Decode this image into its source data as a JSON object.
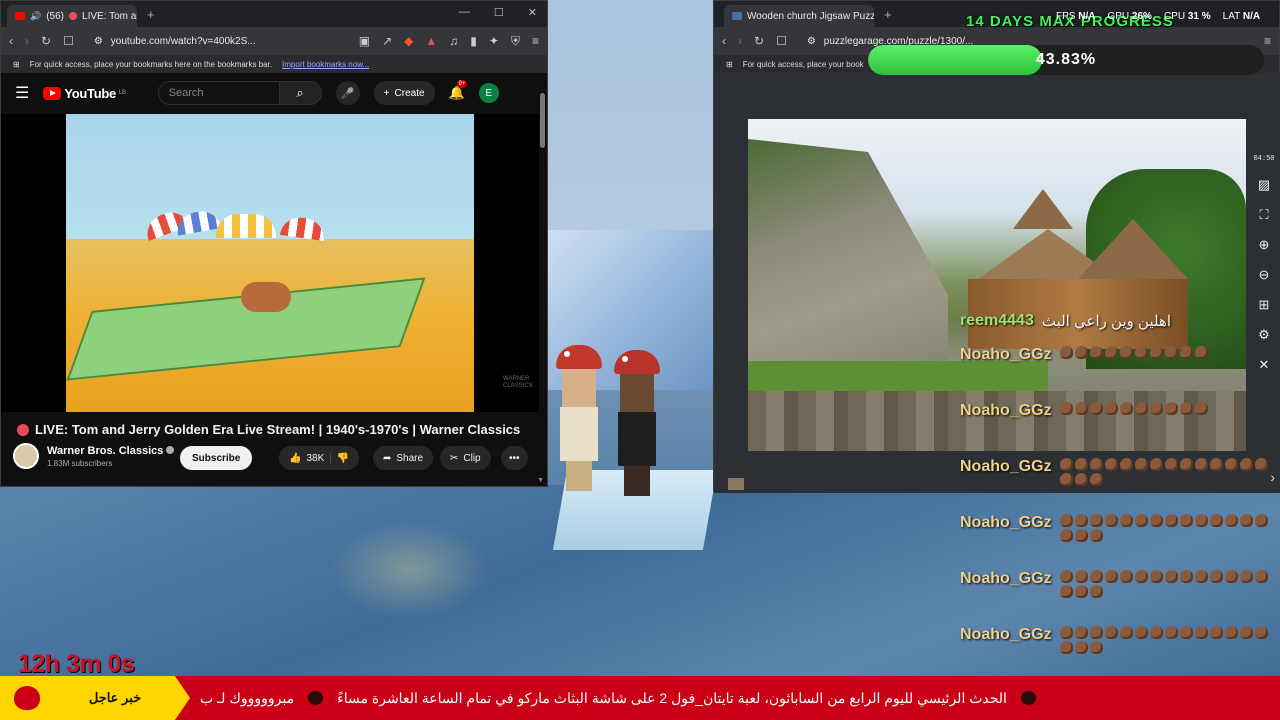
{
  "left_browser": {
    "tab_count": "(56)",
    "tab_title": "LIVE: Tom and Jerry G",
    "url": "youtube.com/watch?v=400k2S...",
    "bookmarks_hint": "For quick access, place your bookmarks here on the bookmarks bar.",
    "import_link": "Import bookmarks now..."
  },
  "youtube": {
    "logo": "YouTube",
    "logo_sup": "LB",
    "search_placeholder": "Search",
    "create_label": "Create",
    "notif_badge": "9+",
    "avatar_letter": "E",
    "video_watermark": "WARNER CLASSICS",
    "video_title": "LIVE: Tom and Jerry Golden Era Live Stream! | 1940's-1970's | Warner Classics",
    "channel_name": "Warner Bros. Classics",
    "subscribers": "1.83M subscribers",
    "subscribe_label": "Subscribe",
    "likes": "38K",
    "share_label": "Share",
    "clip_label": "Clip"
  },
  "right_browser": {
    "tab_title": "Wooden church Jigsaw Puzzle (",
    "url": "puzzlegarage.com/puzzle/1300/...",
    "bookmarks_hint": "For quick access, place your book",
    "timer": "04:50"
  },
  "overlay": {
    "progress_title": "14 DAYS MAX PROGRESS",
    "progress_percent": "43.83%",
    "progress_fraction": 0.4383,
    "fps_label": "FPS",
    "fps_value": "N/A",
    "gpu_label": "GPU",
    "gpu_value": "26%",
    "cpu_label": "CPU",
    "cpu_value": "31 %",
    "lat_label": "LAT",
    "lat_value": "N/A",
    "accent_color": "#3ff05a"
  },
  "chat": [
    {
      "user": "reem4443",
      "message": "اهلين وين راعي البث",
      "emotes": 0
    },
    {
      "user": "Noaho_GGz",
      "message": "",
      "emotes": 10
    },
    {
      "user": "Noaho_GGz",
      "message": "",
      "emotes": 10
    },
    {
      "user": "Noaho_GGz",
      "message": "",
      "emotes": 17
    },
    {
      "user": "Noaho_GGz",
      "message": "",
      "emotes": 17
    },
    {
      "user": "Noaho_GGz",
      "message": "",
      "emotes": 17
    },
    {
      "user": "Noaho_GGz",
      "message": "",
      "emotes": 17
    }
  ],
  "stream": {
    "uptime": "12h 3m 0s",
    "ticker_badge": "خبر عاجل",
    "ticker_text": "الحدث الرئيسي لليوم الرابع من الساباثون، لعبة تايتان_فول 2 على شاشة البثاث ماركو في تمام الساعة العاشرة مساءً",
    "ticker_text_2": "مبروووووك لـ ب"
  }
}
